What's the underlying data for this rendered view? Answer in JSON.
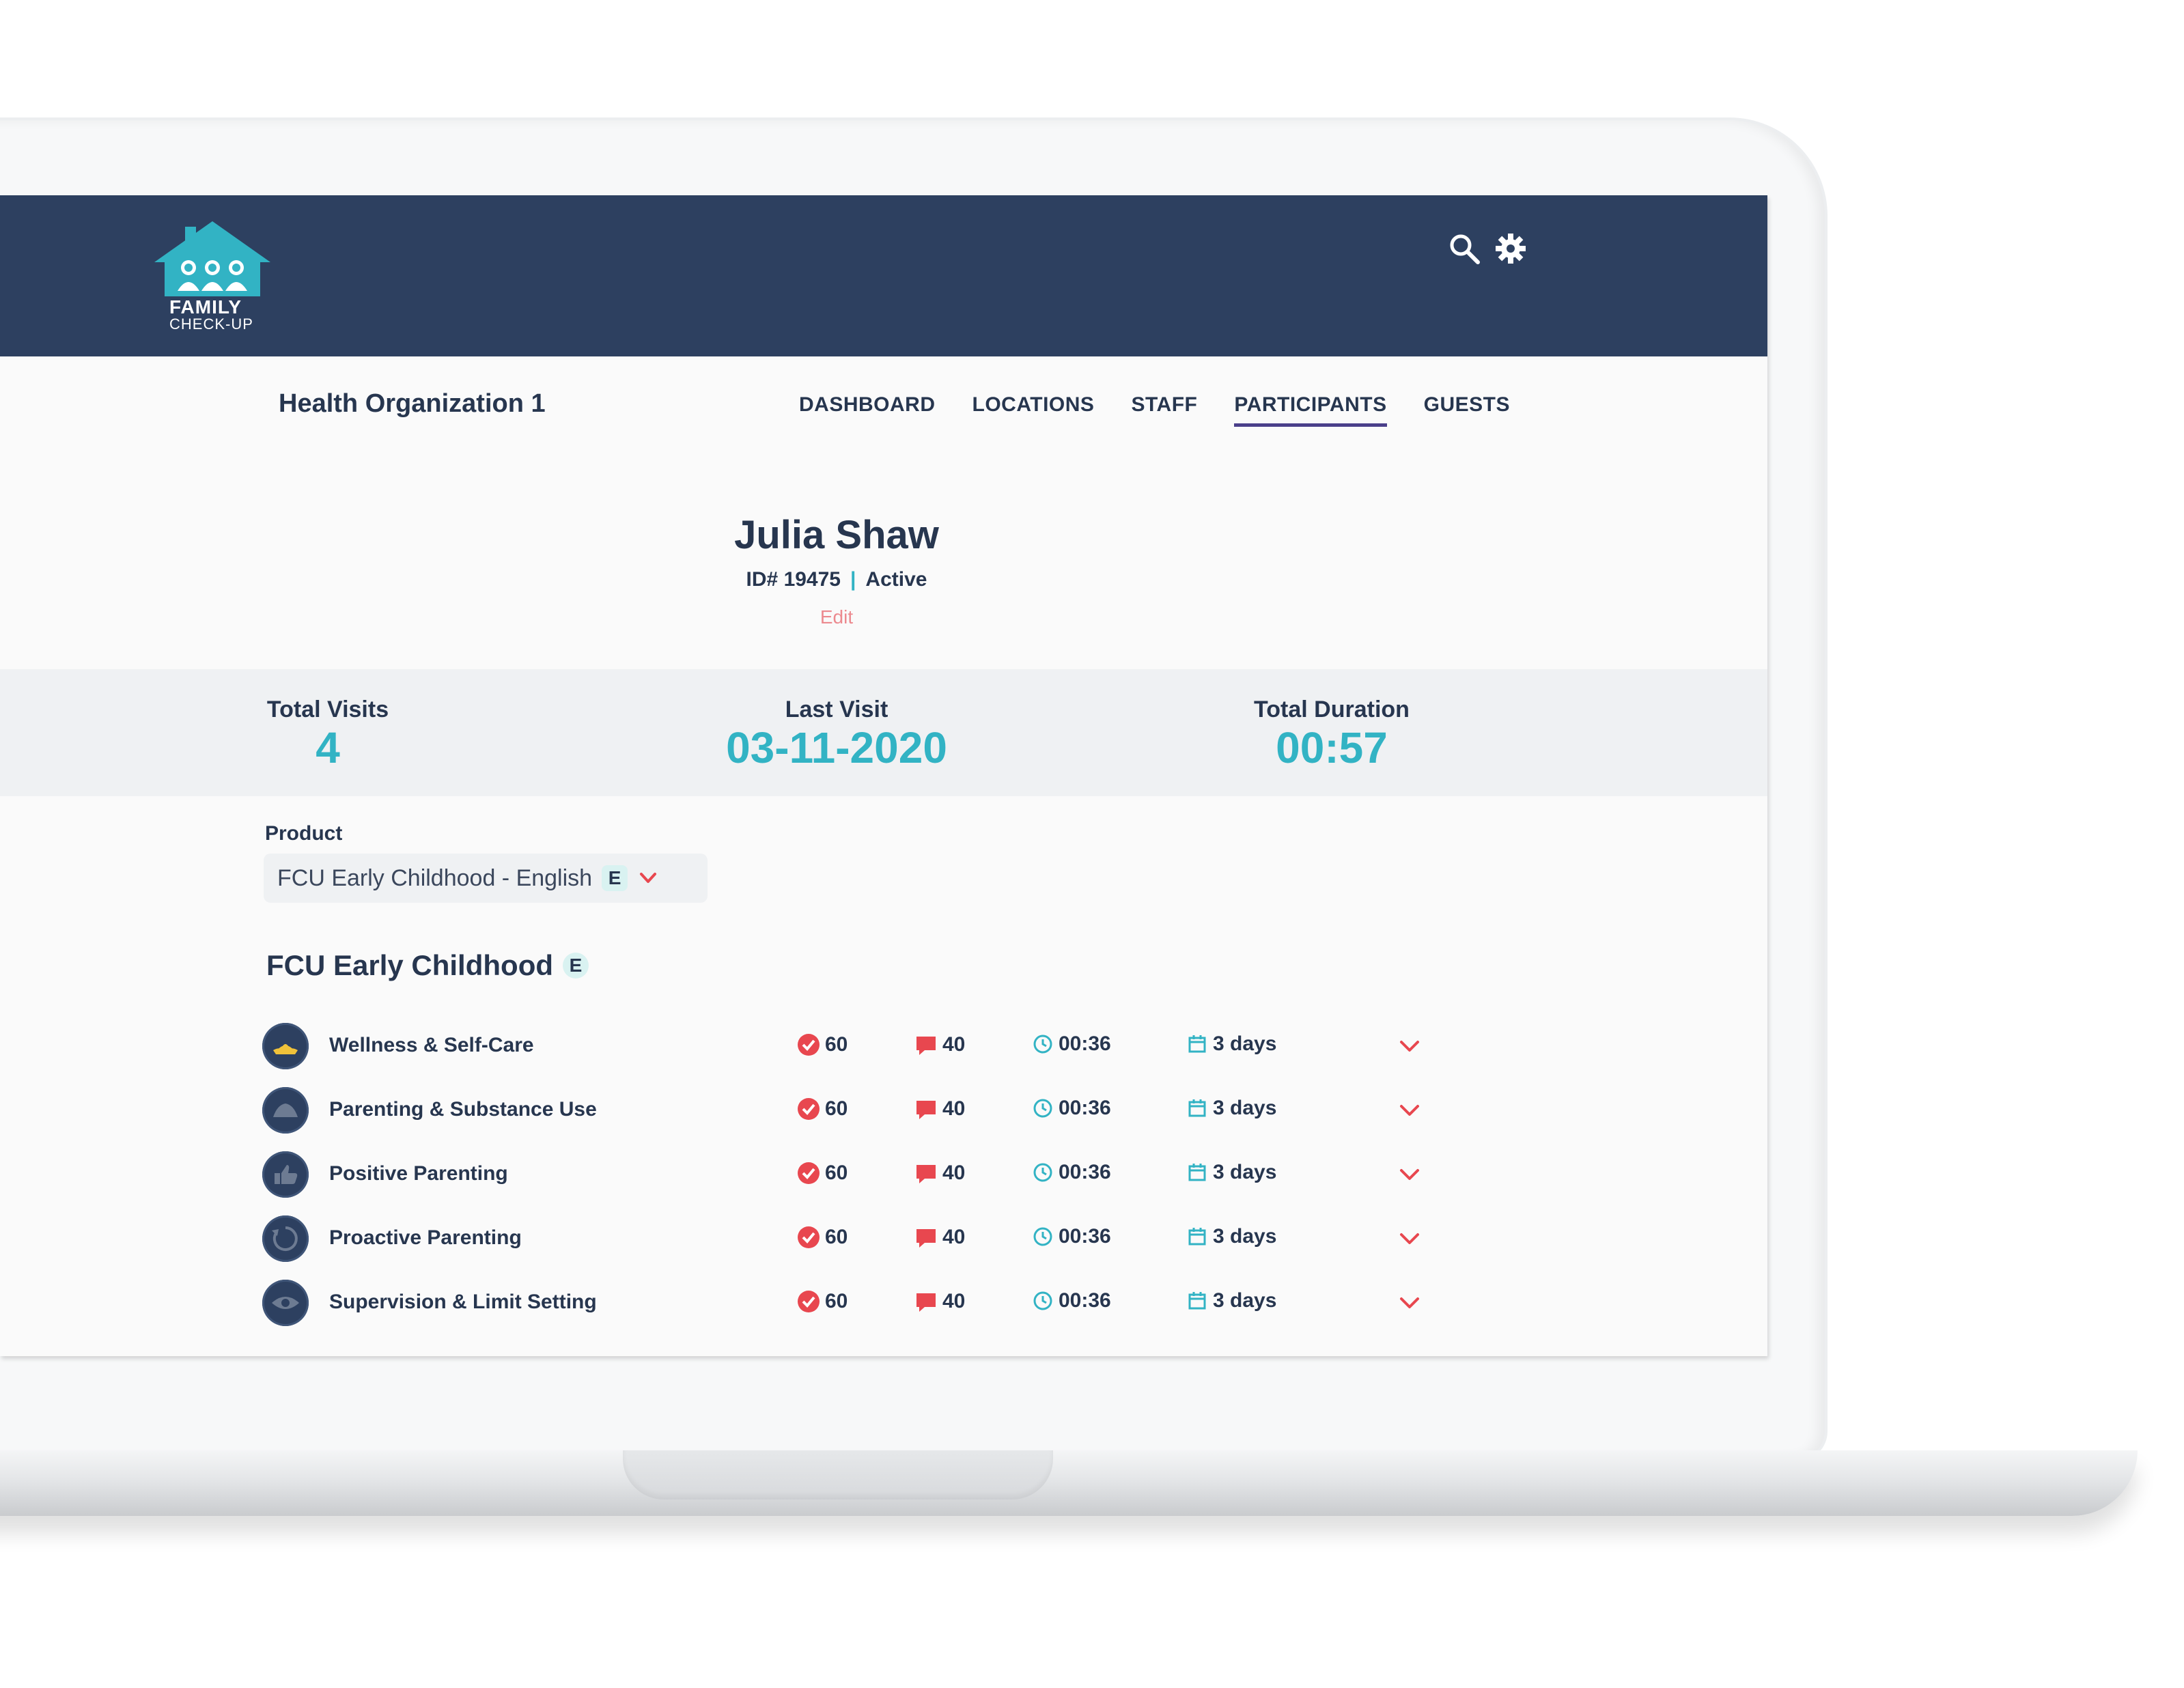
{
  "app": {
    "logo_line1": "FAMILY",
    "logo_line2": "CHECK-UP",
    "org_name": "Health Organization 1"
  },
  "nav": {
    "items": [
      {
        "label": "DASHBOARD"
      },
      {
        "label": "LOCATIONS"
      },
      {
        "label": "STAFF"
      },
      {
        "label": "PARTICIPANTS",
        "active": true
      },
      {
        "label": "GUESTS"
      }
    ]
  },
  "topbar_icons": [
    "search-icon",
    "gear-icon"
  ],
  "participant": {
    "name": "Julia Shaw",
    "id_label": "ID# 19475",
    "separator": "|",
    "status": "Active",
    "edit_label": "Edit"
  },
  "stats": {
    "total_visits_label": "Total Visits",
    "total_visits_value": "4",
    "last_visit_label": "Last Visit",
    "last_visit_value": "03-11-2020",
    "total_duration_label": "Total Duration",
    "total_duration_value": "00:57"
  },
  "product": {
    "label": "Product",
    "selected": "FCU Early Childhood - English",
    "badge": "E"
  },
  "section": {
    "title": "FCU Early Childhood",
    "badge": "E"
  },
  "modules": [
    {
      "label": "Wellness & Self-Care",
      "score": "60",
      "comments": "40",
      "time": "00:36",
      "days": "3 days"
    },
    {
      "label": "Parenting & Substance Use",
      "score": "60",
      "comments": "40",
      "time": "00:36",
      "days": "3 days"
    },
    {
      "label": "Positive Parenting",
      "score": "60",
      "comments": "40",
      "time": "00:36",
      "days": "3 days"
    },
    {
      "label": "Proactive Parenting",
      "score": "60",
      "comments": "40",
      "time": "00:36",
      "days": "3 days"
    },
    {
      "label": "Supervision & Limit Setting",
      "score": "60",
      "comments": "40",
      "time": "00:36",
      "days": "3 days"
    }
  ],
  "colors": {
    "header": "#2d4060",
    "accent_teal": "#32b3c4",
    "edit_pink": "#ec8a8f",
    "alert_red": "#e8474f",
    "text_navy": "#27364f"
  }
}
